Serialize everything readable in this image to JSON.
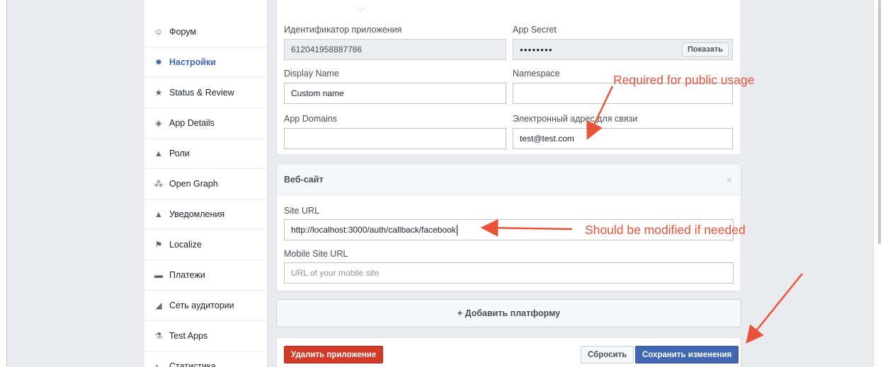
{
  "sidebar": {
    "items": [
      {
        "label": "Форум",
        "icon": "forum-icon",
        "glyph": "☺"
      },
      {
        "label": "Настройки",
        "icon": "gear-icon",
        "glyph": "✸",
        "active": true
      },
      {
        "label": "Status & Review",
        "icon": "star-icon",
        "glyph": "★"
      },
      {
        "label": "App Details",
        "icon": "box-icon",
        "glyph": "◈"
      },
      {
        "label": "Роли",
        "icon": "person-icon",
        "glyph": "▲"
      },
      {
        "label": "Open Graph",
        "icon": "graph-icon",
        "glyph": "⁂"
      },
      {
        "label": "Уведомления",
        "icon": "warning-icon",
        "glyph": "▲"
      },
      {
        "label": "Localize",
        "icon": "flag-icon",
        "glyph": "⚑"
      },
      {
        "label": "Платежи",
        "icon": "card-icon",
        "glyph": "▬"
      },
      {
        "label": "Сеть аудитории",
        "icon": "megaphone-icon",
        "glyph": "◢"
      },
      {
        "label": "Test Apps",
        "icon": "flask-icon",
        "glyph": "⚗"
      },
      {
        "label": "Статистика",
        "icon": "chart-icon",
        "glyph": "⊾"
      }
    ]
  },
  "basic": {
    "app_id_label": "Идентификатор приложения",
    "app_id_value": "612041958887786",
    "app_secret_label": "App Secret",
    "app_secret_value": "●●●●●●●●",
    "show_button": "Показать",
    "display_name_label": "Display Name",
    "display_name_value": "Custom name",
    "namespace_label": "Namespace",
    "namespace_value": "",
    "app_domains_label": "App Domains",
    "app_domains_value": "",
    "contact_email_label": "Электронный адрес для связи",
    "contact_email_value": "test@test.com"
  },
  "website": {
    "title": "Веб-сайт",
    "close": "×",
    "site_url_label": "Site URL",
    "site_url_value": "http://localhost:3000/auth/callback/facebook",
    "mobile_url_label": "Mobile Site URL",
    "mobile_url_placeholder": "URL of your mobile site"
  },
  "add_platform": "+ Добавить платформу",
  "actions": {
    "delete": "Удалить приложение",
    "reset": "Сбросить",
    "save": "Сохранить изменения"
  },
  "annotations": {
    "required": "Required for public usage",
    "modified": "Should be modified if needed"
  },
  "colors": {
    "accent": "#4267b2",
    "danger": "#d23b28",
    "annotation": "#e8533a"
  }
}
